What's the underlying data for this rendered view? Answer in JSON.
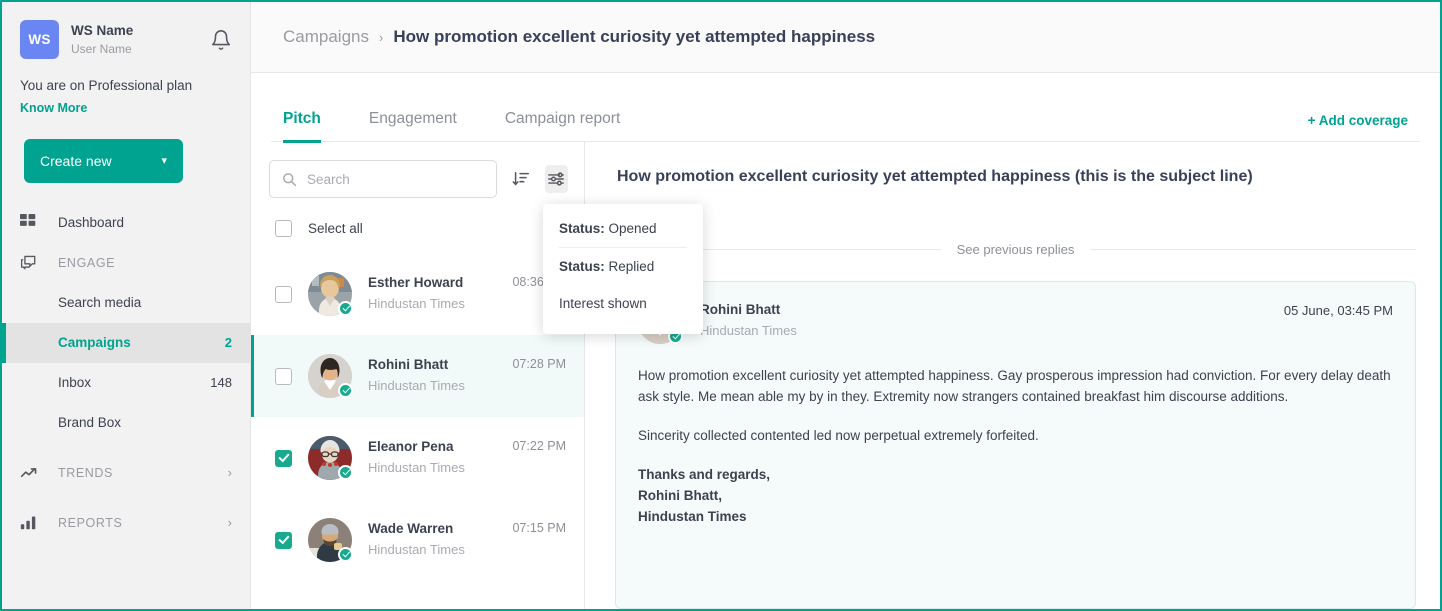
{
  "colors": {
    "accent": "#00a38f",
    "accent_check": "#18a98e",
    "badge_bg": "#6a86f2",
    "title": "#39405a",
    "muted": "#9a9ba2"
  },
  "sidebar": {
    "workspace": {
      "initials": "WS",
      "name": "WS Name",
      "user": "User Name"
    },
    "notification_icon": "bell-icon",
    "plan_text": "You are on Professional plan",
    "know_more_label": "Know More",
    "create_button": {
      "label": "Create new",
      "chevron": "chevron-down-icon"
    },
    "items": [
      {
        "label": "Dashboard",
        "icon": "grid-icon",
        "type": "item",
        "count": ""
      },
      {
        "label": "ENGAGE",
        "icon": "chat-bubbles-icon",
        "type": "section",
        "count": ""
      },
      {
        "label": "Search media",
        "type": "sub",
        "count": ""
      },
      {
        "label": "Campaigns",
        "type": "sub",
        "count": "2",
        "active": true
      },
      {
        "label": "Inbox",
        "type": "sub",
        "count": "148"
      },
      {
        "label": "Brand Box",
        "type": "sub",
        "count": ""
      },
      {
        "label": "TRENDS",
        "icon": "trend-up-icon",
        "type": "section-expand",
        "count": ""
      },
      {
        "label": "REPORTS",
        "icon": "bar-chart-icon",
        "type": "section-expand",
        "count": ""
      }
    ]
  },
  "breadcrumb": {
    "root": "Campaigns",
    "separator": "›",
    "current": "How promotion excellent curiosity yet attempted happiness"
  },
  "tabs": [
    {
      "label": "Pitch",
      "active": true
    },
    {
      "label": "Engagement",
      "active": false
    },
    {
      "label": "Campaign report",
      "active": false
    }
  ],
  "add_coverage_label": "+ Add coverage",
  "list": {
    "search": {
      "placeholder": "Search",
      "value": "",
      "icon": "search-icon"
    },
    "sort_icon": "sort-descending-icon",
    "filter_icon": "filter-sliders-icon",
    "select_all_label": "Select all",
    "select_all_checked": false,
    "rows": [
      {
        "name": "Esther Howard",
        "org": "Hindustan Times",
        "time": "08:36 PM",
        "checked": false,
        "selected": false,
        "verified": true
      },
      {
        "name": "Rohini Bhatt",
        "org": "Hindustan Times",
        "time": "07:28 PM",
        "checked": false,
        "selected": true,
        "verified": true
      },
      {
        "name": "Eleanor Pena",
        "org": "Hindustan Times",
        "time": "07:22 PM",
        "checked": true,
        "selected": false,
        "verified": true
      },
      {
        "name": "Wade Warren",
        "org": "Hindustan Times",
        "time": "07:15 PM",
        "checked": true,
        "selected": false,
        "verified": true
      }
    ]
  },
  "dropdown": {
    "items": [
      {
        "label_bold": "Status:",
        "label": " Opened",
        "divider_after": true
      },
      {
        "label_bold": "Status:",
        "label": " Replied",
        "divider_after": false
      },
      {
        "label_bold": "",
        "label": "Interest shown",
        "divider_after": false
      }
    ]
  },
  "detail": {
    "subject": "How promotion excellent curiosity yet attempted happiness (this is the subject line)",
    "previous_replies_label": "See previous replies",
    "message": {
      "author": "Rohini Bhatt",
      "org": "Hindustan Times",
      "date": "05 June, 03:45 PM",
      "paragraphs": [
        "How promotion excellent curiosity yet attempted happiness. Gay prosperous impression had conviction. For every delay death ask style. Me mean able my by in they. Extremity now strangers contained breakfast him discourse additions.",
        "Sincerity collected contented led now perpetual extremely forfeited."
      ],
      "signature": [
        "Thanks and regards,",
        "Rohini Bhatt,",
        "Hindustan Times"
      ]
    }
  }
}
